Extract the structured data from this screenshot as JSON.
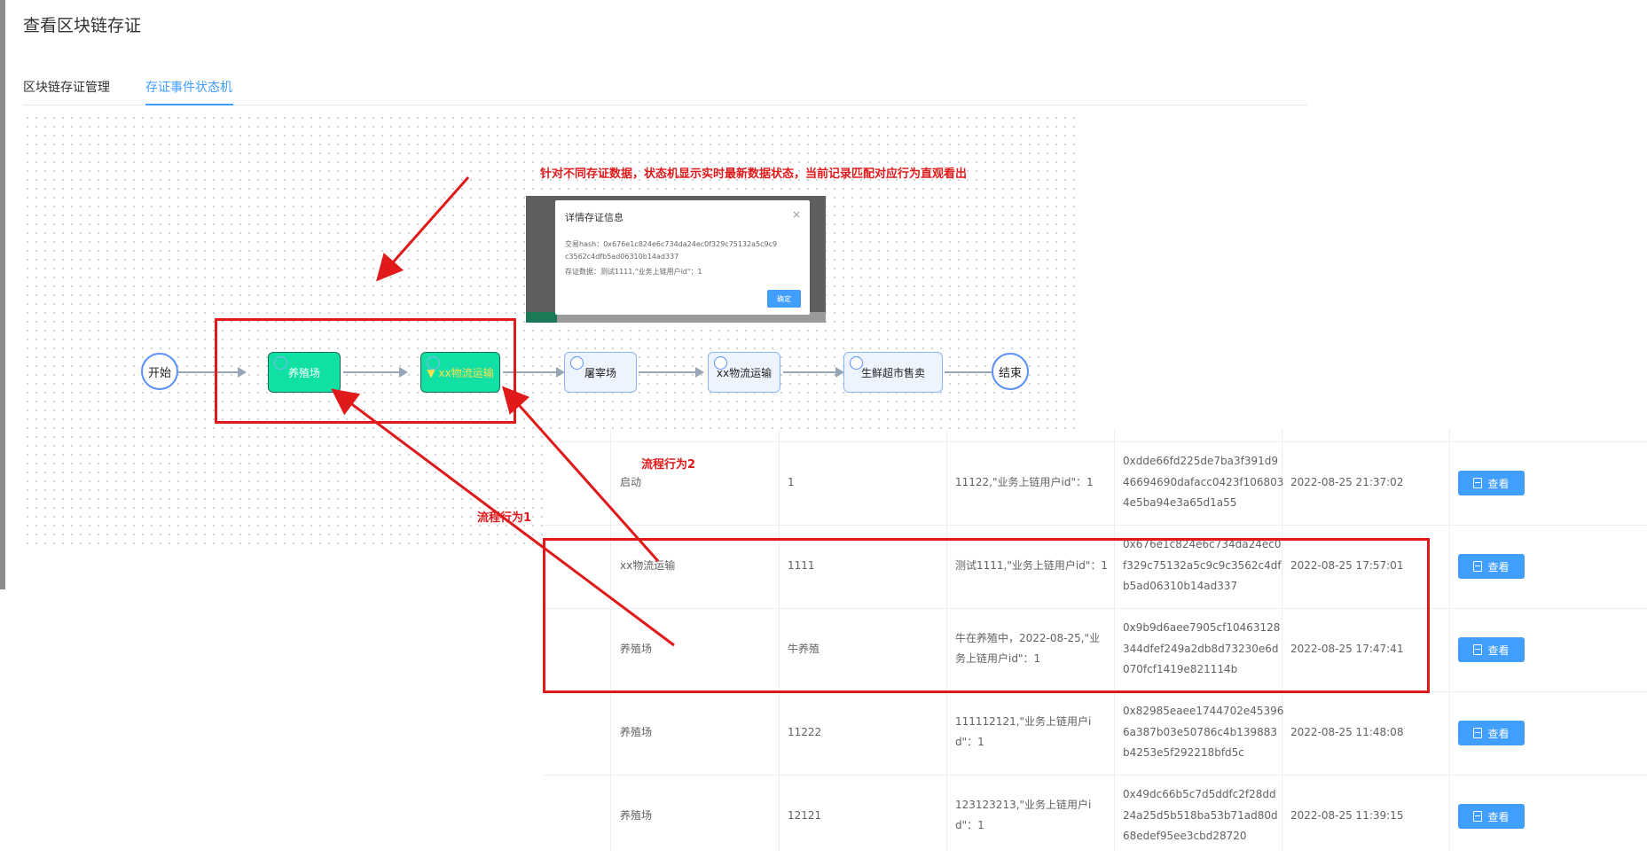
{
  "page": {
    "title": "查看区块链存证"
  },
  "tabs": [
    {
      "label": "区块链存证管理"
    },
    {
      "label": "存证事件状态机"
    }
  ],
  "flow": {
    "start": "开始",
    "end": "结束",
    "nodes": [
      {
        "label": "养殖场",
        "active": true
      },
      {
        "label": "▼ xx物流运输",
        "active": true
      },
      {
        "label": "屠宰场",
        "active": false
      },
      {
        "label": "xx物流运输",
        "active": false
      },
      {
        "label": "生鲜超市售卖",
        "active": false
      }
    ]
  },
  "dialog": {
    "title": "详情存证信息",
    "close": "×",
    "hash_line1": "交易hash：0x676e1c824e6c734da24ec0f329c75132a5c9c9",
    "hash_line2": "c3562c4dfb5ad06310b14ad337",
    "data_line": "存证数据：测试1111,\"业务上链用户id\"：1",
    "confirm": "确定"
  },
  "annotations": {
    "top_note": "针对不同存证数据，状态机显示实时最新数据状态，当前记录匹配对应行为直观看出",
    "behavior1": "流程行为1",
    "behavior2": "流程行为2"
  },
  "table": {
    "view_label": "查看",
    "rows": [
      {
        "status": "启动",
        "name": "1",
        "data1": "11122,\"业务上链用户id\"：1",
        "data2": "",
        "hash1": "0xdde66fd225de7ba3f391d9",
        "hash2": "46694690dafacc0423f106803",
        "hash3": "4e5ba94e3a65d1a55",
        "time": "2022-08-25 21:37:02"
      },
      {
        "status": "xx物流运输",
        "name": "1111",
        "data1": "测试1111,\"业务上链用户id\"：1",
        "data2": "",
        "hash1": "0x676e1c824e6c734da24ec0",
        "hash2": "f329c75132a5c9c9c3562c4df",
        "hash3": "b5ad06310b14ad337",
        "time": "2022-08-25 17:57:01"
      },
      {
        "status": "养殖场",
        "name": "牛养殖",
        "data1": "牛在养殖中，2022-08-25,\"业",
        "data2": "务上链用户id\"：1",
        "hash1": "0x9b9d6aee7905cf10463128",
        "hash2": "344dfef249a2db8d73230e6d",
        "hash3": "070fcf1419e821114b",
        "time": "2022-08-25 17:47:41"
      },
      {
        "status": "养殖场",
        "name": "11222",
        "data1": "111112121,\"业务上链用户i",
        "data2": "d\"：1",
        "hash1": "0x82985eaee1744702e45396",
        "hash2": "6a387b03e50786c4b139883",
        "hash3": "b4253e5f292218bfd5c",
        "time": "2022-08-25 11:48:08"
      },
      {
        "status": "养殖场",
        "name": "12121",
        "data1": "123123213,\"业务上链用户i",
        "data2": "d\"：1",
        "hash1": "0x49dc66b5c7d5ddfc2f28dd",
        "hash2": "24a25d5b518ba53b71ad80d",
        "hash3": "68edef95ee3cbd28720",
        "time": "2022-08-25 11:39:15"
      }
    ]
  },
  "colors": {
    "accent": "#409eff",
    "active_node": "#11e0a5",
    "annotation": "#e0191b"
  }
}
